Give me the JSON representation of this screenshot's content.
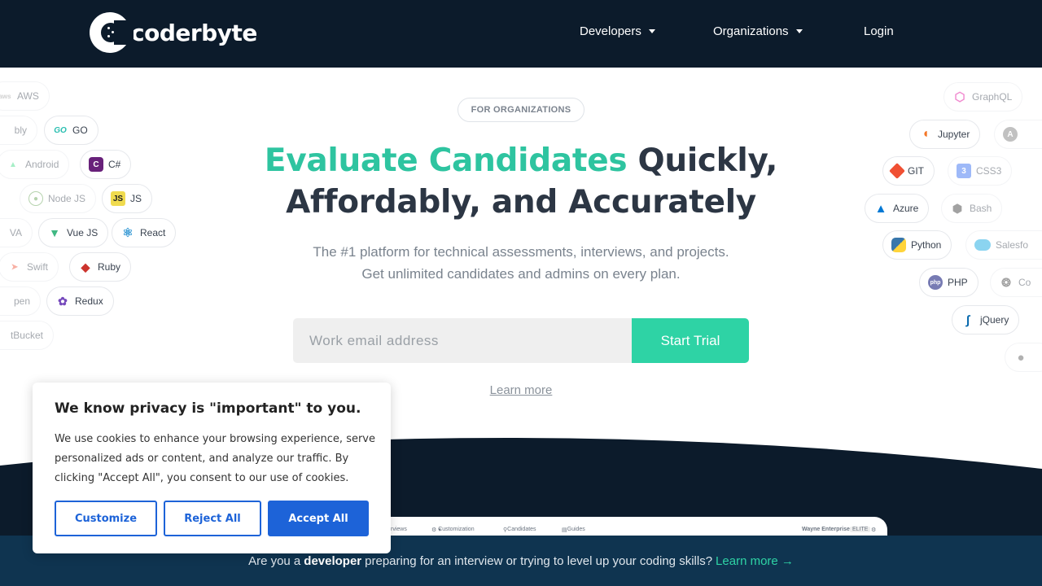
{
  "header": {
    "logo_text": "coderbyte",
    "nav": [
      {
        "label": "Developers"
      },
      {
        "label": "Organizations"
      },
      {
        "label": "Login"
      }
    ]
  },
  "left_pills": [
    {
      "label": "AWS",
      "icon": "aws-icon"
    },
    {
      "label": "bly",
      "icon": ""
    },
    {
      "label": "GO",
      "icon": "go-icon"
    },
    {
      "label": "Android",
      "icon": "android-icon"
    },
    {
      "label": "C#",
      "icon": "csharp-icon"
    },
    {
      "label": "Node JS",
      "icon": "nodejs-icon"
    },
    {
      "label": "JS",
      "icon": "js-icon"
    },
    {
      "label": "VA",
      "icon": ""
    },
    {
      "label": "Vue JS",
      "icon": "vue-icon"
    },
    {
      "label": "React",
      "icon": "react-icon"
    },
    {
      "label": "Swift",
      "icon": "swift-icon"
    },
    {
      "label": "Ruby",
      "icon": "ruby-icon"
    },
    {
      "label": "pen",
      "icon": ""
    },
    {
      "label": "Redux",
      "icon": "redux-icon"
    },
    {
      "label": "tBucket",
      "icon": ""
    }
  ],
  "right_pills": [
    {
      "label": "GraphQL",
      "icon": "graphql-icon"
    },
    {
      "label": "Jupyter",
      "icon": "jupyter-icon"
    },
    {
      "label": "A",
      "icon": "angular-icon"
    },
    {
      "label": "GIT",
      "icon": "git-icon"
    },
    {
      "label": "CSS3",
      "icon": "css3-icon"
    },
    {
      "label": "Azure",
      "icon": "azure-icon"
    },
    {
      "label": "Bash",
      "icon": "bash-icon"
    },
    {
      "label": "Python",
      "icon": "python-icon"
    },
    {
      "label": "Salesfo",
      "icon": "salesforce-icon"
    },
    {
      "label": "PHP",
      "icon": "php-icon"
    },
    {
      "label": "Co",
      "icon": "codepen-icon"
    },
    {
      "label": "jQuery",
      "icon": "jquery-icon"
    },
    {
      "label": "",
      "icon": "apple-icon"
    }
  ],
  "hero": {
    "badge": "FOR ORGANIZATIONS",
    "headline_accent": "Evaluate Candidates",
    "headline_rest_1": " Quickly,",
    "headline_line_2": "Affordably, and Accurately",
    "sub_line_1": "The #1 platform for technical assessments, interviews, and projects.",
    "sub_line_2": "Get unlimited candidates and admins on every plan.",
    "email_placeholder": "Work email address",
    "start_button": "Start Trial",
    "learn_more": "Learn more"
  },
  "preview": {
    "nav": [
      "rviews",
      "Customization",
      "Candidates",
      "Guides"
    ],
    "company": "Wayne Enterprises",
    "tier": "ELITE"
  },
  "bottom_bar": {
    "prefix": "Are you a",
    "bold": "developer",
    "suffix": "preparing for an interview or trying to level up your coding skills?",
    "link": "Learn more →"
  },
  "cookie": {
    "title": "We know privacy is \"important\" to you.",
    "text": "We use cookies to enhance your browsing experience, serve personalized ads or content, and analyze our traffic. By clicking \"Accept All\", you consent to our use of cookies.",
    "customize": "Customize",
    "reject": "Reject All",
    "accept": "Accept All"
  },
  "colors": {
    "header_bg": "#0c1b2b",
    "accent_green": "#2ed3a5",
    "cookie_blue": "#1d63d8",
    "bottom_bar_bg": "#0f3450"
  }
}
